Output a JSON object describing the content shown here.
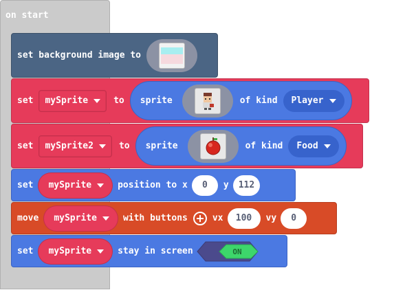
{
  "hat": {
    "label": "on start"
  },
  "background_block": {
    "label": "set background image to",
    "image_icon": "background-image-thumbnail"
  },
  "set_block_1": {
    "set_label": "set",
    "variable": "mySprite",
    "to_label": "to",
    "sprite_label": "sprite",
    "image_icon": "player-character-thumbnail",
    "of_kind_label": "of kind",
    "kind": "Player"
  },
  "set_block_2": {
    "set_label": "set",
    "variable": "mySprite2",
    "to_label": "to",
    "sprite_label": "sprite",
    "image_icon": "apple-thumbnail",
    "of_kind_label": "of kind",
    "kind": "Food"
  },
  "position_block": {
    "set_label": "set",
    "variable": "mySprite",
    "position_label": "position to x",
    "x": "0",
    "y_label": "y",
    "y": "112"
  },
  "move_block": {
    "move_label": "move",
    "variable": "mySprite",
    "buttons_label": "with buttons",
    "vx_label": "vx",
    "vx": "100",
    "vy_label": "vy",
    "vy": "0"
  },
  "stay_block": {
    "set_label": "set",
    "variable": "mySprite",
    "stay_label": "stay in screen",
    "toggle": "ON"
  },
  "colors": {
    "scene_block": "#4b6584",
    "sprite_block": "#e63b5a",
    "position_block": "#4b79e2",
    "controller_block": "#d84b27",
    "hat": "#cbcbcb",
    "toggle_on": "#2ecc71"
  }
}
